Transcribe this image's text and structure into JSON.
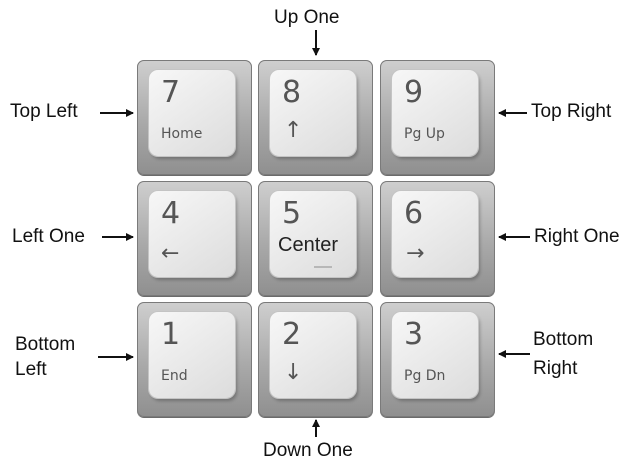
{
  "keys": [
    {
      "digit": "7",
      "sub": "Home"
    },
    {
      "digit": "8",
      "arrow": "↑"
    },
    {
      "digit": "9",
      "sub": "Pg Up"
    },
    {
      "digit": "4",
      "arrow": "←"
    },
    {
      "digit": "5",
      "center": "Center"
    },
    {
      "digit": "6",
      "arrow": "→"
    },
    {
      "digit": "1",
      "sub": "End"
    },
    {
      "digit": "2",
      "arrow": "↓"
    },
    {
      "digit": "3",
      "sub": "Pg Dn"
    }
  ],
  "labels": {
    "up_one": "Up One",
    "top_left": "Top Left",
    "top_right": "Top Right",
    "left_one": "Left One",
    "right_one": "Right One",
    "bottom_left_1": "Bottom",
    "bottom_left_2": "Left",
    "bottom_right_1": "Bottom",
    "bottom_right_2": "Right",
    "down_one": "Down One"
  },
  "colors": {
    "key_frame": "#a9a9a9",
    "key_cap": "#ebebeb",
    "legend": "#555555",
    "label_text": "#111111"
  }
}
